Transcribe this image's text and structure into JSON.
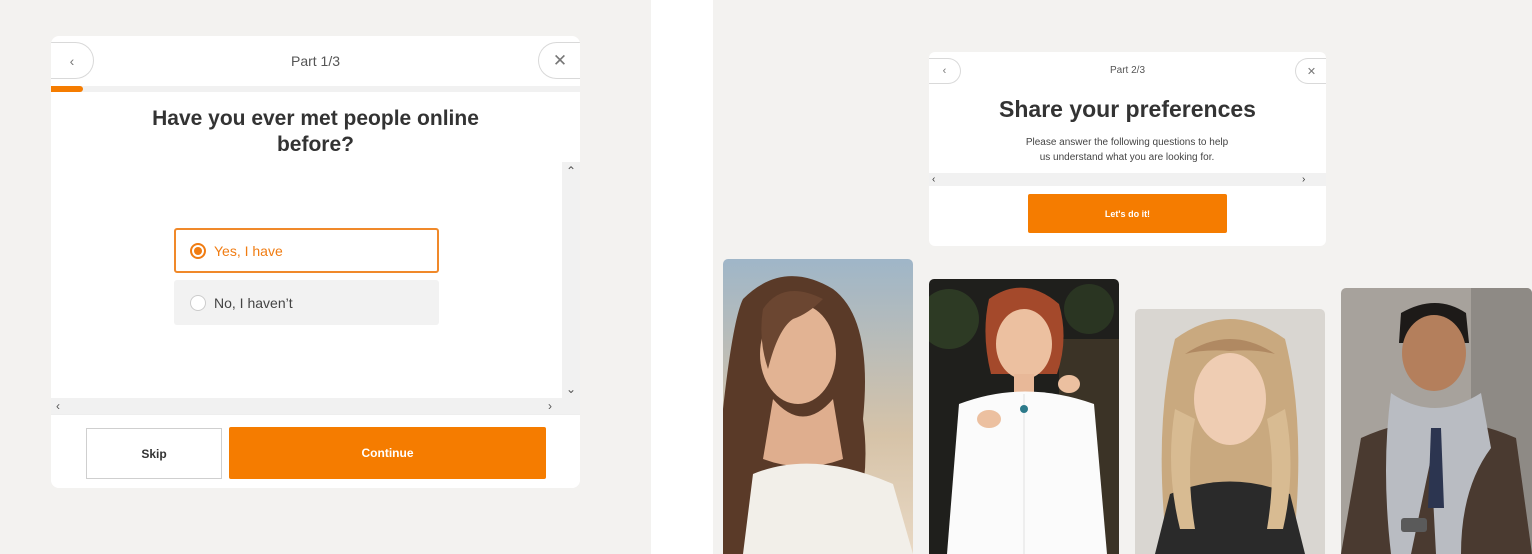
{
  "left_card": {
    "part_label": "Part 1/3",
    "progress_fraction": 0.06,
    "question": "Have you ever met people online before?",
    "options": [
      {
        "label": "Yes, I have",
        "selected": true
      },
      {
        "label": "No, I haven’t",
        "selected": false
      }
    ],
    "skip_label": "Skip",
    "continue_label": "Continue",
    "back_icon": "chevron-left-icon",
    "close_icon": "close-icon"
  },
  "right_card": {
    "part_label": "Part 2/3",
    "title": "Share your preferences",
    "subtitle_line1": "Please answer the following questions to help",
    "subtitle_line2": "us understand what you are looking for.",
    "cta_label": "Let's do it!",
    "back_icon": "chevron-left-icon",
    "close_icon": "close-icon"
  },
  "profile_photos": [
    {
      "name": "woman-long-brown-hair-photo"
    },
    {
      "name": "woman-white-shirt-photo"
    },
    {
      "name": "woman-blonde-wavy-hair-photo"
    },
    {
      "name": "man-grey-scarf-photo"
    }
  ],
  "colors": {
    "accent": "#f57c00",
    "background": "#f3f2f0",
    "card": "#ffffff"
  }
}
